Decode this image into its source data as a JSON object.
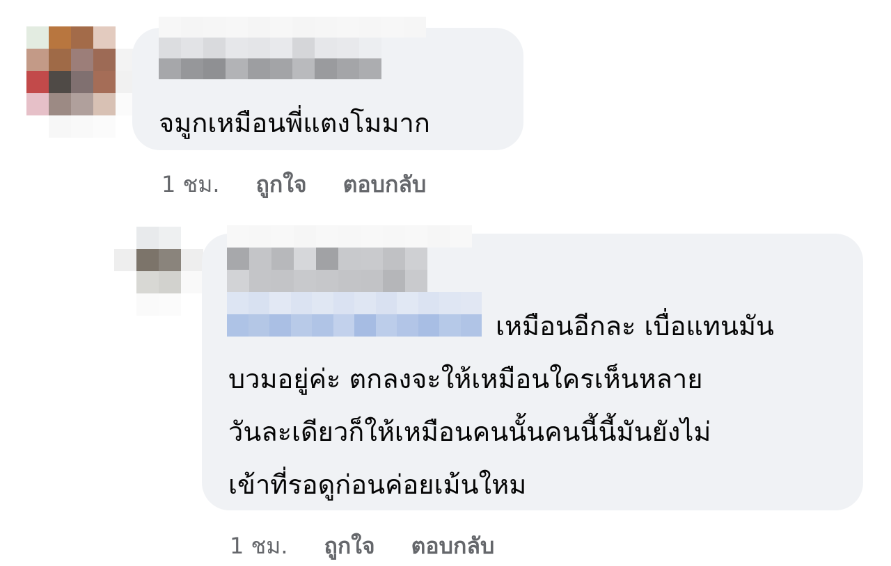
{
  "comments": [
    {
      "text": "จมูกเหมือนพี่แตงโมมาก",
      "time": "1 ชม.",
      "like_label": "ถูกใจ",
      "reply_label": "ตอบกลับ",
      "name_redacted": true
    },
    {
      "text_lines": [
        "เหมือนอีกละ เบื่อแทนมัน",
        "บวมอยู่ค่ะ ตกลงจะให้เหมือนใครเห็นหลาย",
        "วันละเดียวก็ให้เหมือนคนนั้นคนนี้นี้มันยังไม่",
        "เข้าที่รอดูก่อนค่อยเม้นใหม"
      ],
      "time": "1 ชม.",
      "like_label": "ถูกใจ",
      "reply_label": "ตอบกลับ",
      "name_redacted": true,
      "mention_redacted": true
    }
  ],
  "colors": {
    "bubble": "#f0f2f5",
    "text": "#050505",
    "meta": "#65676b",
    "mention_blur": "#b3c6e6"
  }
}
